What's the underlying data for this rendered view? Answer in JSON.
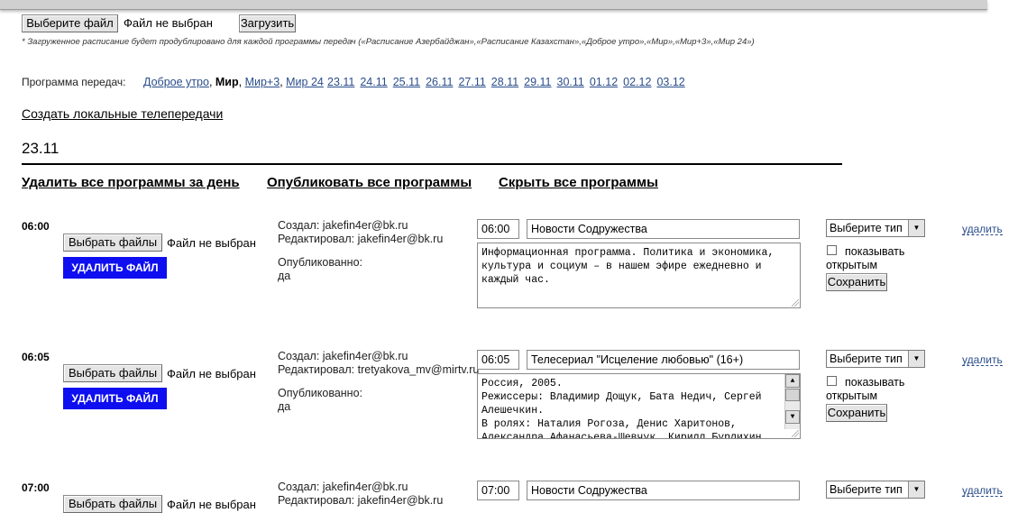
{
  "upload": {
    "choose_file_label": "Выберите файл",
    "no_file_text": "Файл не выбран",
    "upload_label": "Загрузить",
    "note": "* Загруженное расписание будет продублировано для каждой программы передач («Расписание Азербайджан»,«Расписание Казахстан»,«Доброе утро»,«Мир»,«Мир+3»,«Мир 24»)"
  },
  "program_nav": {
    "label": "Программа передач:",
    "programs": [
      {
        "label": "Доброе утро",
        "sep": ", "
      },
      {
        "label": "Мир",
        "sep": ", ",
        "active": true
      },
      {
        "label": "Мир+3",
        "sep": ", "
      },
      {
        "label": "Мир 24",
        "sep": ""
      }
    ],
    "dates": [
      "23.11",
      "24.11",
      "25.11",
      "26.11",
      "27.11",
      "28.11",
      "29.11",
      "30.11",
      "01.12",
      "02.12",
      "03.12"
    ]
  },
  "create_local_link": "Создать локальные телепередачи",
  "current_date": "23.11",
  "day_actions": {
    "delete_all": "Удалить все программы за день",
    "publish_all": "Опубликовать все программы",
    "hide_all": "Скрыть все программы"
  },
  "entries": [
    {
      "time_heading": "06:00",
      "choose_files_label": "Выбрать файлы",
      "no_file_text": "Файл не выбран",
      "delete_file_label": "УДАЛИТЬ ФАЙЛ",
      "created": "Создал: jakefin4er@bk.ru",
      "edited": "Редактировал: jakefin4er@bk.ru",
      "published_label": "Опубликованно:",
      "published_value": "да",
      "time_value": "06:00",
      "title_value": "Новости Содружества",
      "description": "Информационная программа. Политика и экономика,\nкультура и социум – в нашем эфире ежедневно и\nкаждый час.",
      "type_select": "Выберите тип",
      "show_open_label": "показывать\nоткрытым",
      "save_label": "Сохранить",
      "delete_link": "удалить"
    },
    {
      "time_heading": "06:05",
      "choose_files_label": "Выбрать файлы",
      "no_file_text": "Файл не выбран",
      "delete_file_label": "УДАЛИТЬ ФАЙЛ",
      "created": "Создал: jakefin4er@bk.ru",
      "edited": "Редактировал: tretyakova_mv@mirtv.ru",
      "published_label": "Опубликованно:",
      "published_value": "да",
      "time_value": "06:05",
      "title_value": "Телесериал \"Исцеление любовью\" (16+)",
      "description": "Россия, 2005.\nРежиссеры: Владимир Дощук, Бата Недич, Сергей\nАлешечкин.\nВ ролях: Наталия Рогоза, Денис Харитонов,\nАлександра Афанасьева-Шевчук, Кирилл Бурлихин",
      "type_select": "Выберите тип",
      "show_open_label": "показывать\nоткрытым",
      "save_label": "Сохранить",
      "delete_link": "удалить"
    },
    {
      "time_heading": "07:00",
      "choose_files_label": "Выбрать файлы",
      "no_file_text": "Файл не выбран",
      "created": "Создал: jakefin4er@bk.ru",
      "edited": "Редактировал: jakefin4er@bk.ru",
      "time_value": "07:00",
      "title_value": "Новости Содружества",
      "type_select": "Выберите тип",
      "delete_link": "удалить"
    }
  ]
}
